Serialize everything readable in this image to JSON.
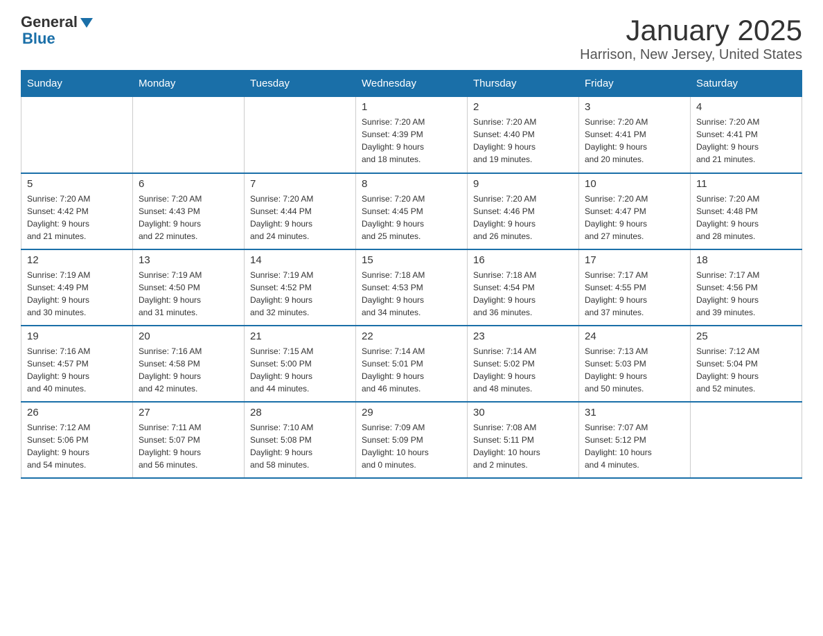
{
  "logo": {
    "text_general": "General",
    "text_blue": "Blue"
  },
  "title": "January 2025",
  "subtitle": "Harrison, New Jersey, United States",
  "weekdays": [
    "Sunday",
    "Monday",
    "Tuesday",
    "Wednesday",
    "Thursday",
    "Friday",
    "Saturday"
  ],
  "weeks": [
    [
      {
        "day": "",
        "info": ""
      },
      {
        "day": "",
        "info": ""
      },
      {
        "day": "",
        "info": ""
      },
      {
        "day": "1",
        "info": "Sunrise: 7:20 AM\nSunset: 4:39 PM\nDaylight: 9 hours\nand 18 minutes."
      },
      {
        "day": "2",
        "info": "Sunrise: 7:20 AM\nSunset: 4:40 PM\nDaylight: 9 hours\nand 19 minutes."
      },
      {
        "day": "3",
        "info": "Sunrise: 7:20 AM\nSunset: 4:41 PM\nDaylight: 9 hours\nand 20 minutes."
      },
      {
        "day": "4",
        "info": "Sunrise: 7:20 AM\nSunset: 4:41 PM\nDaylight: 9 hours\nand 21 minutes."
      }
    ],
    [
      {
        "day": "5",
        "info": "Sunrise: 7:20 AM\nSunset: 4:42 PM\nDaylight: 9 hours\nand 21 minutes."
      },
      {
        "day": "6",
        "info": "Sunrise: 7:20 AM\nSunset: 4:43 PM\nDaylight: 9 hours\nand 22 minutes."
      },
      {
        "day": "7",
        "info": "Sunrise: 7:20 AM\nSunset: 4:44 PM\nDaylight: 9 hours\nand 24 minutes."
      },
      {
        "day": "8",
        "info": "Sunrise: 7:20 AM\nSunset: 4:45 PM\nDaylight: 9 hours\nand 25 minutes."
      },
      {
        "day": "9",
        "info": "Sunrise: 7:20 AM\nSunset: 4:46 PM\nDaylight: 9 hours\nand 26 minutes."
      },
      {
        "day": "10",
        "info": "Sunrise: 7:20 AM\nSunset: 4:47 PM\nDaylight: 9 hours\nand 27 minutes."
      },
      {
        "day": "11",
        "info": "Sunrise: 7:20 AM\nSunset: 4:48 PM\nDaylight: 9 hours\nand 28 minutes."
      }
    ],
    [
      {
        "day": "12",
        "info": "Sunrise: 7:19 AM\nSunset: 4:49 PM\nDaylight: 9 hours\nand 30 minutes."
      },
      {
        "day": "13",
        "info": "Sunrise: 7:19 AM\nSunset: 4:50 PM\nDaylight: 9 hours\nand 31 minutes."
      },
      {
        "day": "14",
        "info": "Sunrise: 7:19 AM\nSunset: 4:52 PM\nDaylight: 9 hours\nand 32 minutes."
      },
      {
        "day": "15",
        "info": "Sunrise: 7:18 AM\nSunset: 4:53 PM\nDaylight: 9 hours\nand 34 minutes."
      },
      {
        "day": "16",
        "info": "Sunrise: 7:18 AM\nSunset: 4:54 PM\nDaylight: 9 hours\nand 36 minutes."
      },
      {
        "day": "17",
        "info": "Sunrise: 7:17 AM\nSunset: 4:55 PM\nDaylight: 9 hours\nand 37 minutes."
      },
      {
        "day": "18",
        "info": "Sunrise: 7:17 AM\nSunset: 4:56 PM\nDaylight: 9 hours\nand 39 minutes."
      }
    ],
    [
      {
        "day": "19",
        "info": "Sunrise: 7:16 AM\nSunset: 4:57 PM\nDaylight: 9 hours\nand 40 minutes."
      },
      {
        "day": "20",
        "info": "Sunrise: 7:16 AM\nSunset: 4:58 PM\nDaylight: 9 hours\nand 42 minutes."
      },
      {
        "day": "21",
        "info": "Sunrise: 7:15 AM\nSunset: 5:00 PM\nDaylight: 9 hours\nand 44 minutes."
      },
      {
        "day": "22",
        "info": "Sunrise: 7:14 AM\nSunset: 5:01 PM\nDaylight: 9 hours\nand 46 minutes."
      },
      {
        "day": "23",
        "info": "Sunrise: 7:14 AM\nSunset: 5:02 PM\nDaylight: 9 hours\nand 48 minutes."
      },
      {
        "day": "24",
        "info": "Sunrise: 7:13 AM\nSunset: 5:03 PM\nDaylight: 9 hours\nand 50 minutes."
      },
      {
        "day": "25",
        "info": "Sunrise: 7:12 AM\nSunset: 5:04 PM\nDaylight: 9 hours\nand 52 minutes."
      }
    ],
    [
      {
        "day": "26",
        "info": "Sunrise: 7:12 AM\nSunset: 5:06 PM\nDaylight: 9 hours\nand 54 minutes."
      },
      {
        "day": "27",
        "info": "Sunrise: 7:11 AM\nSunset: 5:07 PM\nDaylight: 9 hours\nand 56 minutes."
      },
      {
        "day": "28",
        "info": "Sunrise: 7:10 AM\nSunset: 5:08 PM\nDaylight: 9 hours\nand 58 minutes."
      },
      {
        "day": "29",
        "info": "Sunrise: 7:09 AM\nSunset: 5:09 PM\nDaylight: 10 hours\nand 0 minutes."
      },
      {
        "day": "30",
        "info": "Sunrise: 7:08 AM\nSunset: 5:11 PM\nDaylight: 10 hours\nand 2 minutes."
      },
      {
        "day": "31",
        "info": "Sunrise: 7:07 AM\nSunset: 5:12 PM\nDaylight: 10 hours\nand 4 minutes."
      },
      {
        "day": "",
        "info": ""
      }
    ]
  ]
}
